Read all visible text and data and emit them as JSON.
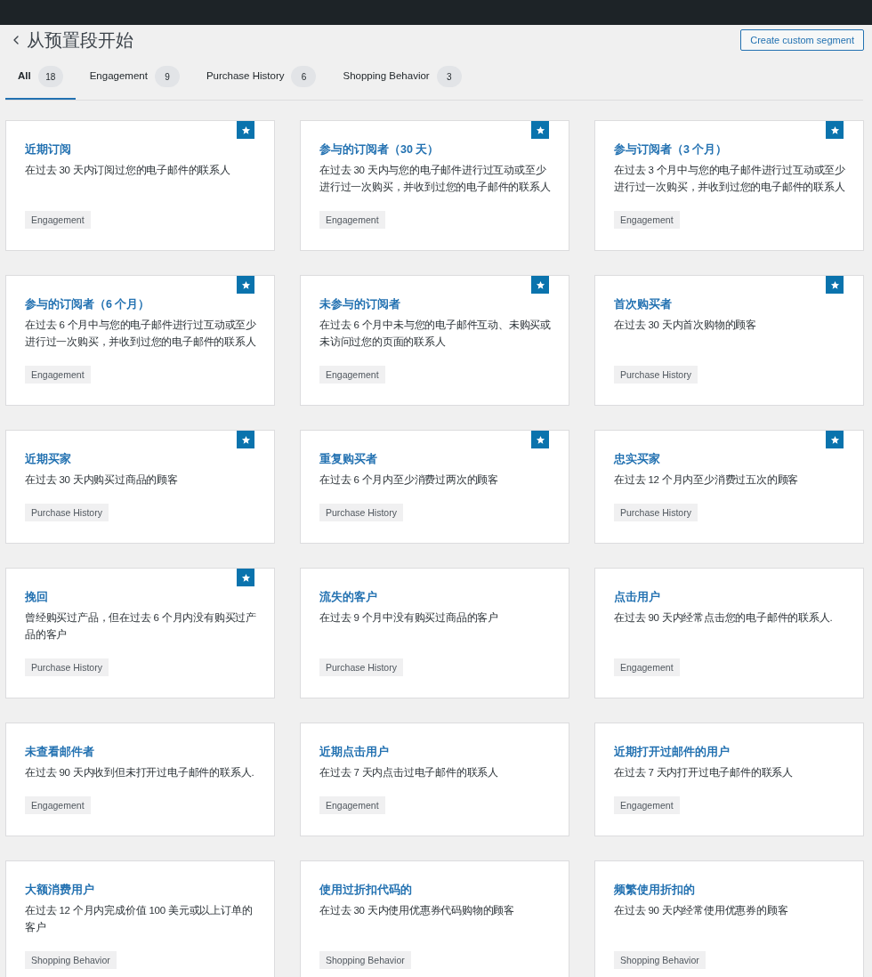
{
  "header": {
    "title": "从预置段开始",
    "create_button": "Create custom segment"
  },
  "tabs": [
    {
      "label": "All",
      "count": "18",
      "selected": true
    },
    {
      "label": "Engagement",
      "count": "9",
      "selected": false
    },
    {
      "label": "Purchase History",
      "count": "6",
      "selected": false
    },
    {
      "label": "Shopping Behavior",
      "count": "3",
      "selected": false
    }
  ],
  "segments": [
    {
      "title": "近期订阅",
      "description": "在过去 30 天内订阅过您的电子邮件的联系人",
      "tag": "Engagement",
      "featured": true
    },
    {
      "title": "参与的订阅者（30 天）",
      "description": "在过去 30 天内与您的电子邮件进行过互动或至少进行过一次购买，并收到过您的电子邮件的联系人",
      "tag": "Engagement",
      "featured": true
    },
    {
      "title": "参与订阅者（3 个月）",
      "description": "在过去 3 个月中与您的电子邮件进行过互动或至少进行过一次购买，并收到过您的电子邮件的联系人",
      "tag": "Engagement",
      "featured": true
    },
    {
      "title": "参与的订阅者（6 个月）",
      "description": "在过去 6 个月中与您的电子邮件进行过互动或至少进行过一次购买，并收到过您的电子邮件的联系人",
      "tag": "Engagement",
      "featured": true
    },
    {
      "title": "未参与的订阅者",
      "description": "在过去 6 个月中未与您的电子邮件互动、未购买或未访问过您的页面的联系人",
      "tag": "Engagement",
      "featured": true
    },
    {
      "title": "首次购买者",
      "description": "在过去 30 天内首次购物的顾客",
      "tag": "Purchase History",
      "featured": true
    },
    {
      "title": "近期买家",
      "description": "在过去 30 天内购买过商品的顾客",
      "tag": "Purchase History",
      "featured": true
    },
    {
      "title": "重复购买者",
      "description": "在过去 6 个月内至少消费过两次的顾客",
      "tag": "Purchase History",
      "featured": true
    },
    {
      "title": "忠实买家",
      "description": "在过去 12 个月内至少消费过五次的顾客",
      "tag": "Purchase History",
      "featured": true
    },
    {
      "title": "挽回",
      "description": "曾经购买过产品，但在过去 6 个月内没有购买过产品的客户",
      "tag": "Purchase History",
      "featured": true
    },
    {
      "title": "流失的客户",
      "description": "在过去 9 个月中没有购买过商品的客户",
      "tag": "Purchase History",
      "featured": false
    },
    {
      "title": "点击用户",
      "description": "在过去 90 天内经常点击您的电子邮件的联系人.",
      "tag": "Engagement",
      "featured": false
    },
    {
      "title": "未查看邮件者",
      "description": "在过去 90 天内收到但未打开过电子邮件的联系人.",
      "tag": "Engagement",
      "featured": false
    },
    {
      "title": "近期点击用户",
      "description": "在过去 7 天内点击过电子邮件的联系人",
      "tag": "Engagement",
      "featured": false
    },
    {
      "title": "近期打开过邮件的用户",
      "description": "在过去 7 天内打开过电子邮件的联系人",
      "tag": "Engagement",
      "featured": false
    },
    {
      "title": "大额消费用户",
      "description": "在过去 12 个月内完成价值 100 美元或以上订单的客户",
      "tag": "Shopping Behavior",
      "featured": false
    },
    {
      "title": "使用过折扣代码的",
      "description": "在过去 30 天内使用优惠券代码购物的顾客",
      "tag": "Shopping Behavior",
      "featured": false
    },
    {
      "title": "频繁使用折扣的",
      "description": "在过去 90 天内经常使用优惠券的顾客",
      "tag": "Shopping Behavior",
      "featured": false
    }
  ]
}
